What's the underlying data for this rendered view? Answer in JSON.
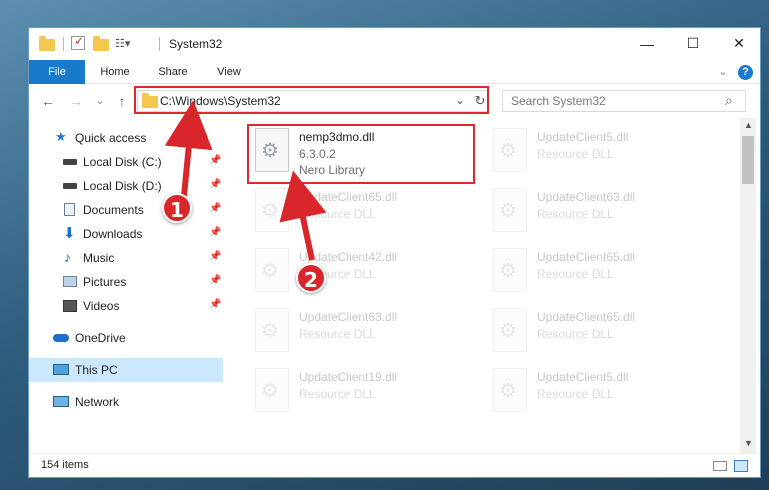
{
  "window": {
    "title": "System32",
    "minimize": "—",
    "maximize": "☐",
    "close": "✕",
    "chevron": "⌄",
    "help": "?"
  },
  "ribbon": {
    "tabs": [
      "File",
      "Home",
      "Share",
      "View"
    ]
  },
  "address": {
    "path": "C:\\Windows\\System32",
    "search_placeholder": "Search System32",
    "back": "←",
    "forward": "→",
    "recent": "⌄",
    "up": "↑",
    "dropdown": "⌄",
    "refresh": "↻",
    "search_icon": "⌕"
  },
  "nav": {
    "pin": "📌",
    "items": [
      {
        "label": "Quick access",
        "icon": "star-icon"
      },
      {
        "label": "Local Disk (C:)",
        "icon": "drive-icon"
      },
      {
        "label": "Local Disk (D:)",
        "icon": "drive-icon"
      },
      {
        "label": "Documents",
        "icon": "documents-icon"
      },
      {
        "label": "Downloads",
        "icon": "downloads-icon"
      },
      {
        "label": "Music",
        "icon": "music-icon"
      },
      {
        "label": "Pictures",
        "icon": "pictures-icon"
      },
      {
        "label": "Videos",
        "icon": "videos-icon"
      },
      {
        "label": "OneDrive",
        "icon": "cloud-icon"
      },
      {
        "label": "This PC",
        "icon": "computer-icon"
      },
      {
        "label": "Network",
        "icon": "network-icon"
      }
    ]
  },
  "files": [
    {
      "name": "nemp3dmo.dll",
      "version": "6.3.0.2",
      "type": "Nero Library"
    },
    {
      "name": "UpdateClient5.dll",
      "type": "Resource DLL"
    },
    {
      "name": "UpdateClient65.dll",
      "type": "Resource DLL"
    },
    {
      "name": "UpdateClient63.dll",
      "type": "Resource DLL"
    },
    {
      "name": "UpdateClient42.dll",
      "type": "Resource DLL"
    },
    {
      "name": "UpdateClient65.dll",
      "type": "Resource DLL"
    },
    {
      "name": "UpdateClient63.dll",
      "type": "Resource DLL"
    },
    {
      "name": "UpdateClient65.dll",
      "type": "Resource DLL"
    },
    {
      "name": "UpdateClient19.dll",
      "type": "Resource DLL"
    },
    {
      "name": "UpdateClient5.dll",
      "type": "Resource DLL"
    }
  ],
  "status": {
    "items_count": "154 items"
  },
  "annotations": {
    "step1": "1",
    "step2": "2"
  },
  "colors": {
    "accent": "#1979ca",
    "highlight": "#e0282d",
    "selection": "#cce8ff"
  }
}
